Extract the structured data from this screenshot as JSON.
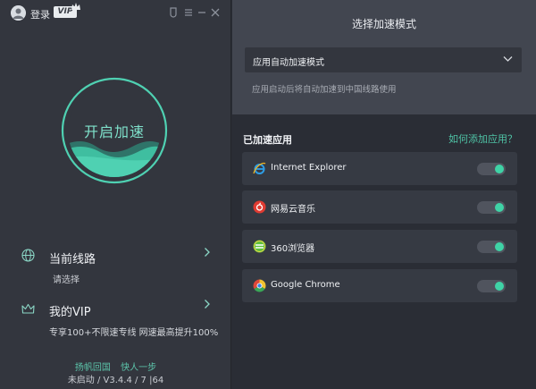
{
  "header": {
    "login_label": "登录",
    "vip_badge": "VIP"
  },
  "accelerate": {
    "label": "开启加速",
    "accent_color": "#4fd1b2"
  },
  "route": {
    "title": "当前线路",
    "subtitle": "请选择"
  },
  "vip": {
    "title": "我的VIP",
    "subtitle": "专享100+不限速专线 网速最高提升100%"
  },
  "footer": {
    "link_1": "扬帆回国",
    "link_2": "快人一步",
    "version": "未启动 / V3.4.4 / 7 |64"
  },
  "mode": {
    "title": "选择加速模式",
    "selected": "应用自动加速模式",
    "description": "应用启动后将自动加速到中国线路使用"
  },
  "apps": {
    "title": "已加速应用",
    "add_link": "如何添加应用？",
    "items": [
      {
        "name": "Internet Explorer",
        "icon": "ie-icon",
        "enabled": true
      },
      {
        "name": "网易云音乐",
        "icon": "netease-music-icon",
        "enabled": true
      },
      {
        "name": "360浏览器",
        "icon": "360-browser-icon",
        "enabled": true
      },
      {
        "name": "Google Chrome",
        "icon": "chrome-icon",
        "enabled": true
      }
    ]
  }
}
